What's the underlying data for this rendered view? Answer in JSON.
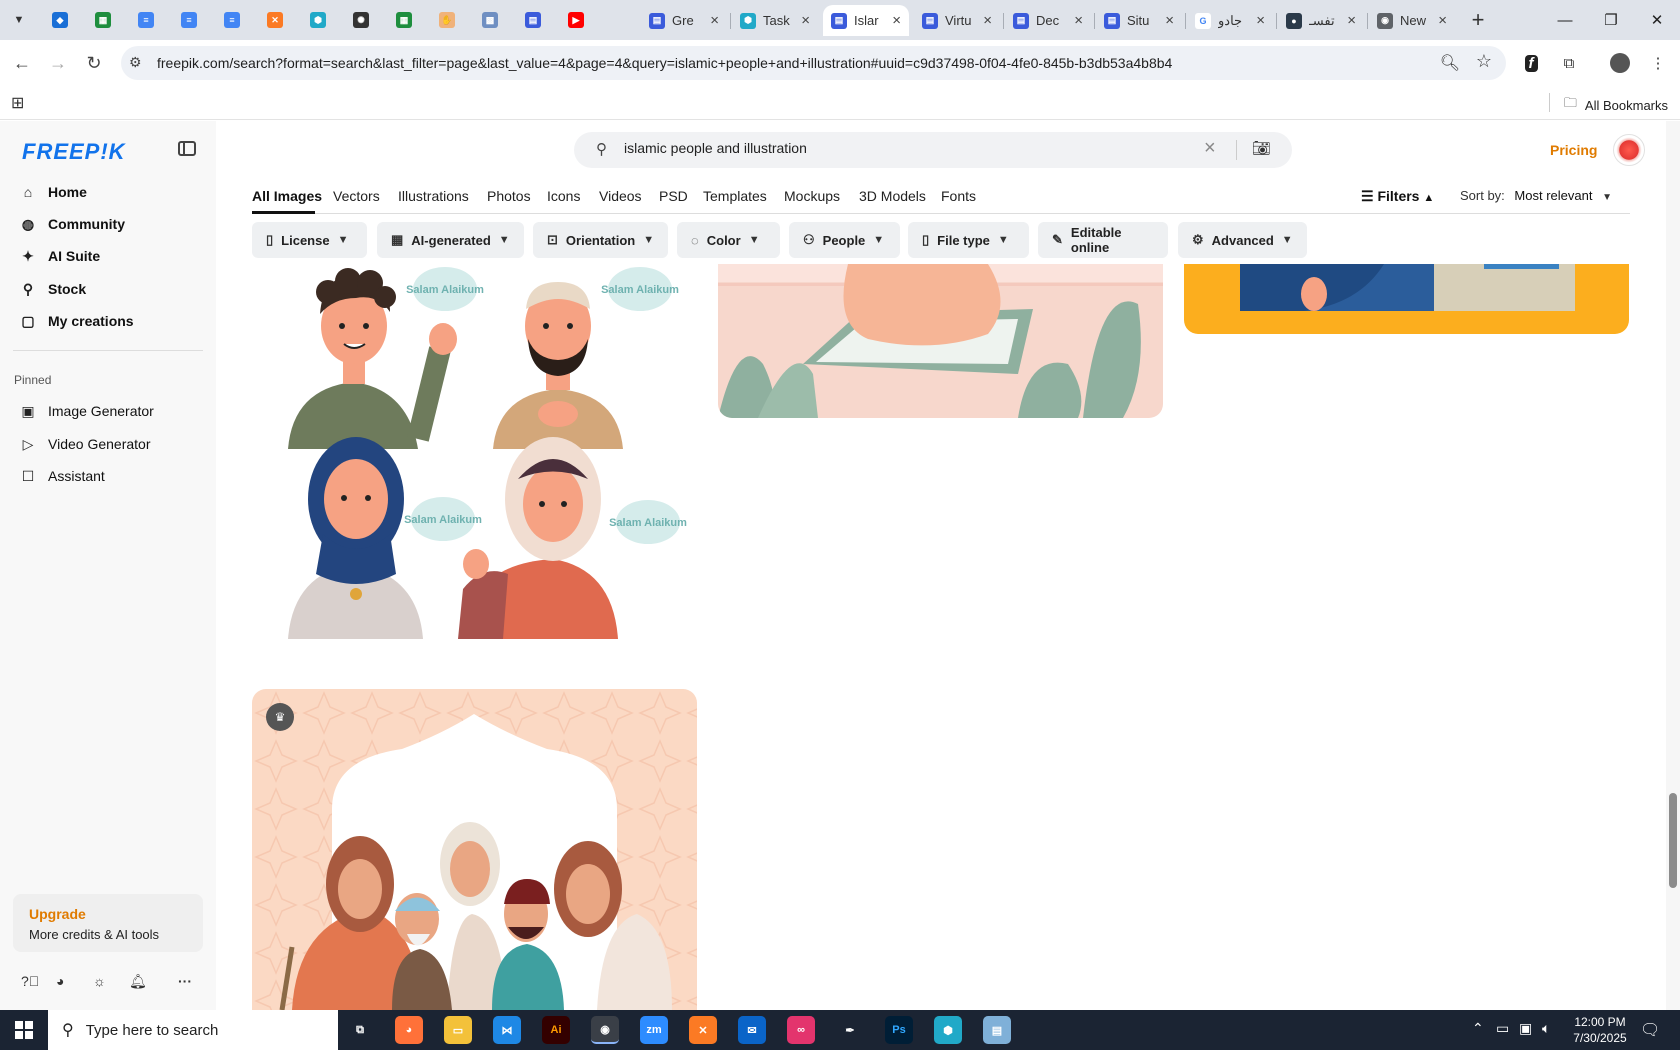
{
  "browser": {
    "pinned_tabs": [
      {
        "icon": "vpn-icon",
        "color": "#1a6fd6"
      },
      {
        "icon": "sheets-icon",
        "color": "#1e8e3e"
      },
      {
        "icon": "docs-icon",
        "color": "#4285f4"
      },
      {
        "icon": "docs-icon",
        "color": "#4285f4"
      },
      {
        "icon": "docs-icon",
        "color": "#4285f4"
      },
      {
        "icon": "xampp-icon",
        "color": "#fb7a24"
      },
      {
        "icon": "polygon-icon",
        "color": "#21a9c8"
      },
      {
        "icon": "openai-icon",
        "color": "#333333"
      },
      {
        "icon": "sheets-icon",
        "color": "#1e8e3e"
      },
      {
        "icon": "hand-icon",
        "color": "#f0b27a"
      },
      {
        "icon": "qr-icon",
        "color": "#6f8fc2"
      },
      {
        "icon": "forms-icon",
        "color": "#3b5bdb"
      },
      {
        "icon": "youtube-icon",
        "color": "#ff0000"
      }
    ],
    "tabs": [
      {
        "title": "Gre",
        "icon": "forms-icon",
        "color": "#3b5bdb",
        "active": false
      },
      {
        "title": "Task",
        "icon": "polygon-icon",
        "color": "#21a9c8",
        "active": false
      },
      {
        "title": "Islar",
        "icon": "forms-icon",
        "color": "#3b5bdb",
        "active": true
      },
      {
        "title": "Virtu",
        "icon": "forms-icon",
        "color": "#3b5bdb",
        "active": false
      },
      {
        "title": "Dec",
        "icon": "forms-icon",
        "color": "#3b5bdb",
        "active": false
      },
      {
        "title": "Situ",
        "icon": "forms-icon",
        "color": "#3b5bdb",
        "active": false
      },
      {
        "title": "جادو",
        "icon": "google-icon",
        "color": "#ffffff",
        "active": false
      },
      {
        "title": "تفسـ",
        "icon": "site-icon",
        "color": "#2b3a4a",
        "active": false
      },
      {
        "title": "New",
        "icon": "chrome-icon",
        "color": "#5f6368",
        "active": false
      }
    ],
    "url": "freepik.com/search?format=search&last_filter=page&last_value=4&page=4&query=islamic+people+and+illustration#uuid=c9d37498-0f04-4fe0-845b-b3db53a4b8b4",
    "bookmarks_label": "All Bookmarks"
  },
  "sidebar": {
    "logo": "FREEP!K",
    "nav": [
      {
        "label": "Home",
        "icon": "home-icon"
      },
      {
        "label": "Community",
        "icon": "globe-icon"
      },
      {
        "label": "AI Suite",
        "icon": "sparkle-icon"
      },
      {
        "label": "Stock",
        "icon": "search-icon"
      },
      {
        "label": "My creations",
        "icon": "folder-icon"
      }
    ],
    "pinned_label": "Pinned",
    "pinned": [
      {
        "label": "Image Generator",
        "icon": "image-icon"
      },
      {
        "label": "Video Generator",
        "icon": "video-icon"
      },
      {
        "label": "Assistant",
        "icon": "chat-icon"
      }
    ],
    "upgrade": {
      "title": "Upgrade",
      "subtitle": "More credits & AI tools"
    }
  },
  "header": {
    "search_value": "islamic people and illustration",
    "pricing": "Pricing"
  },
  "content_tabs": [
    "All Images",
    "Vectors",
    "Illustrations",
    "Photos",
    "Icons",
    "Videos",
    "PSD",
    "Templates",
    "Mockups",
    "3D Models",
    "Fonts"
  ],
  "filters_label": "Filters",
  "sort": {
    "label": "Sort by:",
    "value": "Most relevant"
  },
  "filter_chips": [
    {
      "label": "License",
      "icon": "license-icon"
    },
    {
      "label": "AI-generated",
      "icon": "ai-icon"
    },
    {
      "label": "Orientation",
      "icon": "orientation-icon"
    },
    {
      "label": "Color",
      "icon": "palette-icon"
    },
    {
      "label": "People",
      "icon": "people-icon"
    },
    {
      "label": "File type",
      "icon": "file-icon"
    },
    {
      "label": "Editable online",
      "icon": "edit-icon"
    },
    {
      "label": "Advanced",
      "icon": "gear-icon"
    }
  ],
  "speech_bubbles": [
    "Salam Alaikum",
    "Salam Alaikum",
    "Salam Alaikum",
    "Salam Alaikum"
  ],
  "taskbar": {
    "search_placeholder": "Type here to search",
    "time": "12:00 PM",
    "date": "7/30/2025",
    "apps": [
      {
        "icon": "task-view-icon",
        "text": ""
      },
      {
        "icon": "firefox-icon",
        "text": ""
      },
      {
        "icon": "file-explorer-icon",
        "text": ""
      },
      {
        "icon": "vscode-icon",
        "text": ""
      },
      {
        "icon": "illustrator-icon",
        "text": "Ai"
      },
      {
        "icon": "chrome-icon",
        "text": ""
      },
      {
        "icon": "zoom-icon",
        "text": "zm"
      },
      {
        "icon": "xampp-icon",
        "text": ""
      },
      {
        "icon": "outlook-icon",
        "text": ""
      },
      {
        "icon": "creative-cloud-icon",
        "text": ""
      },
      {
        "icon": "pen-icon",
        "text": ""
      },
      {
        "icon": "photoshop-icon",
        "text": "Ps"
      },
      {
        "icon": "polygon-icon",
        "text": ""
      },
      {
        "icon": "notepad-icon",
        "text": ""
      }
    ]
  }
}
